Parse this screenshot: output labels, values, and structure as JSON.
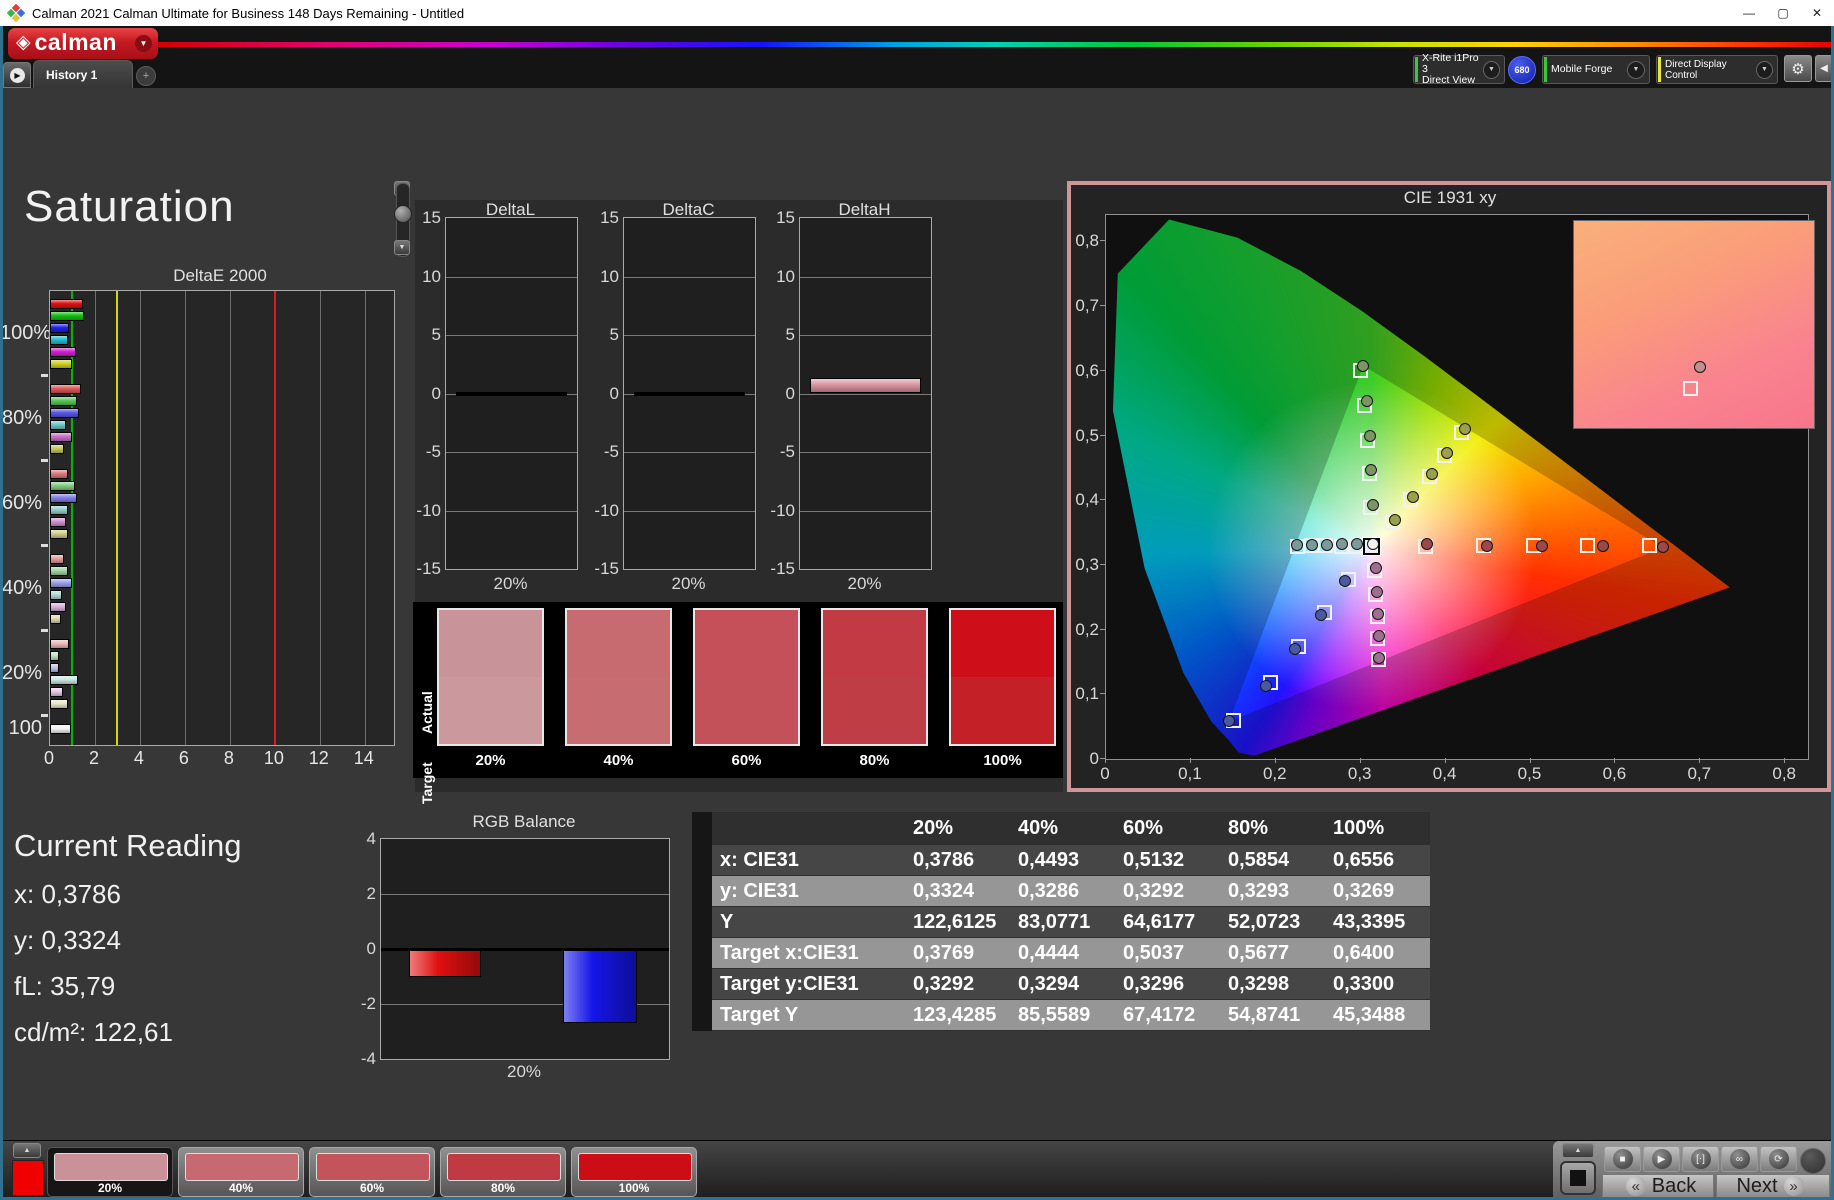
{
  "titlebar": {
    "title": "Calman 2021 Calman Ultimate for Business 148 Days Remaining  - Untitled",
    "buttons": [
      {
        "name": "minimize-button",
        "glyph": "—"
      },
      {
        "name": "maximize-button",
        "glyph": "▢"
      },
      {
        "name": "close-button",
        "glyph": "✕"
      }
    ]
  },
  "appbar": {
    "logo_text": "calman",
    "logo_diamond_glyph": "◈",
    "logo_arrow_glyph": "▼"
  },
  "tabs": {
    "play_glyph": "▶",
    "history_label": "History 1",
    "add_label": "+"
  },
  "meters": {
    "meter_line1": "X-Rite i1Pro 3",
    "meter_line2": "Direct View",
    "badge": "680",
    "source_label": "Mobile Forge",
    "control_label": "Direct Display Control",
    "gear_glyph": "⚙",
    "collapse_glyph": "◀",
    "meter_accent": "#3cc83c",
    "source_accent": "#3cc83c",
    "control_accent": "#e8e83c"
  },
  "page": {
    "title": "Saturation"
  },
  "deltae": {
    "title": "DeltaE 2000",
    "type": "bar",
    "axis_max": 15.3,
    "x_ticks": [
      "0",
      "2",
      "4",
      "6",
      "8",
      "10",
      "12",
      "14"
    ],
    "x_tick_values": [
      0,
      2,
      4,
      6,
      8,
      10,
      12,
      14
    ],
    "thresholds": [
      {
        "value": 1,
        "color": "#00b400"
      },
      {
        "value": 3,
        "color": "#d8d800"
      },
      {
        "value": 10,
        "color": "#e01818"
      }
    ],
    "groups": [
      {
        "label": "100%",
        "values": [
          1.47,
          1.51,
          0.86,
          0.79,
          1.16,
          0.97
        ],
        "colors": [
          "#e01010",
          "#10c010",
          "#2020f0",
          "#20c0d0",
          "#d020d0",
          "#d0d020"
        ]
      },
      {
        "label": "80%",
        "values": [
          1.37,
          1.22,
          1.27,
          0.72,
          0.97,
          0.61
        ],
        "colors": [
          "#df5858",
          "#58c858",
          "#5858e8",
          "#70c8c8",
          "#c870c8",
          "#c8c860"
        ]
      },
      {
        "label": "60%",
        "values": [
          0.82,
          1.09,
          1.22,
          0.79,
          0.69,
          0.79
        ],
        "colors": [
          "#e07878",
          "#80d080",
          "#8080e8",
          "#90d0cc",
          "#d090d0",
          "#d0d088"
        ]
      },
      {
        "label": "40%",
        "values": [
          0.61,
          0.79,
          0.99,
          0.52,
          0.72,
          0.48
        ],
        "colors": [
          "#e49c9c",
          "#a0d8a0",
          "#a0a0ec",
          "#b0dcd8",
          "#dcb0dc",
          "#dcdca8"
        ]
      },
      {
        "label": "20%",
        "values": [
          0.83,
          0.42,
          0.38,
          1.24,
          0.56,
          0.79
        ],
        "colors": [
          "#ecb8b8",
          "#c0e4c0",
          "#c0c0f0",
          "#cce8e4",
          "#e8c8e8",
          "#e8e8c8"
        ]
      },
      {
        "label": "100",
        "values": [
          0.93
        ],
        "colors": [
          "#f5f5f5"
        ]
      }
    ]
  },
  "delta_charts": {
    "x_label": "20%",
    "y_ticks": [
      "15",
      "10",
      "5",
      "0",
      "-5",
      "-10",
      "-15"
    ],
    "y_tick_values": [
      15,
      10,
      5,
      0,
      -5,
      -10,
      -15
    ],
    "charts": [
      {
        "title": "DeltaL",
        "value": 0.0,
        "color": "#111111"
      },
      {
        "title": "DeltaC",
        "value": 0.0,
        "color": "#111111"
      },
      {
        "title": "DeltaH",
        "value": 1.3,
        "color": "#d893a0"
      }
    ]
  },
  "swatch_strip": {
    "row_labels": [
      "Actual",
      "Target"
    ],
    "columns": [
      {
        "label": "20%",
        "actual": "#c9939a",
        "target": "#cb989e"
      },
      {
        "label": "40%",
        "actual": "#c76b70",
        "target": "#c76d72"
      },
      {
        "label": "60%",
        "actual": "#c65059",
        "target": "#c35159"
      },
      {
        "label": "80%",
        "actual": "#c23b44",
        "target": "#bf3e46"
      },
      {
        "label": "100%",
        "actual": "#ce0e18",
        "target": "#c32028"
      }
    ]
  },
  "cie": {
    "title": "CIE 1931 xy",
    "x_ticks": [
      "0",
      "0,1",
      "0,2",
      "0,3",
      "0,4",
      "0,5",
      "0,6",
      "0,7",
      "0,8"
    ],
    "y_ticks": [
      "0",
      "0,1",
      "0,2",
      "0,3",
      "0,4",
      "0,5",
      "0,6",
      "0,7",
      "0,8"
    ],
    "tick_values": [
      0,
      0.1,
      0.2,
      0.3,
      0.4,
      0.5,
      0.6,
      0.7,
      0.8
    ],
    "white_point": {
      "target": [
        0.3127,
        0.329
      ],
      "measured": [
        0.315,
        0.332
      ],
      "circle_color": "#f2f2f2"
    },
    "gamut_triangle": [
      [
        0.6556,
        0.3269
      ],
      [
        0.303,
        0.608
      ],
      [
        0.145,
        0.058
      ]
    ],
    "locus": [
      [
        0.1741,
        0.005
      ],
      [
        0.156,
        0.01
      ],
      [
        0.144,
        0.0297
      ],
      [
        0.1241,
        0.0578
      ],
      [
        0.0913,
        0.1327
      ],
      [
        0.0454,
        0.295
      ],
      [
        0.0082,
        0.5384
      ],
      [
        0.0139,
        0.7502
      ],
      [
        0.0743,
        0.8338
      ],
      [
        0.1547,
        0.8059
      ],
      [
        0.2296,
        0.7543
      ],
      [
        0.3016,
        0.6923
      ],
      [
        0.3731,
        0.6245
      ],
      [
        0.4441,
        0.5547
      ],
      [
        0.5125,
        0.4866
      ],
      [
        0.5752,
        0.4242
      ],
      [
        0.627,
        0.3725
      ],
      [
        0.6658,
        0.334
      ],
      [
        0.6915,
        0.3083
      ],
      [
        0.7347,
        0.2653
      ]
    ],
    "sweeps": [
      {
        "name": "red",
        "circle_color": "#9a4848",
        "targets": [
          [
            0.3769,
            0.3292
          ],
          [
            0.4444,
            0.3294
          ],
          [
            0.5037,
            0.3296
          ],
          [
            0.5677,
            0.3298
          ],
          [
            0.64,
            0.33
          ]
        ],
        "measured": [
          [
            0.3786,
            0.3324
          ],
          [
            0.4493,
            0.3286
          ],
          [
            0.5132,
            0.3292
          ],
          [
            0.5854,
            0.3293
          ],
          [
            0.6556,
            0.3269
          ]
        ]
      },
      {
        "name": "green",
        "circle_color": "#7d9464",
        "targets": [
          [
            0.3118,
            0.3888
          ],
          [
            0.3102,
            0.4408
          ],
          [
            0.308,
            0.493
          ],
          [
            0.3047,
            0.546
          ],
          [
            0.3,
            0.6
          ]
        ],
        "measured": [
          [
            0.314,
            0.393
          ],
          [
            0.3125,
            0.446
          ],
          [
            0.3105,
            0.499
          ],
          [
            0.3075,
            0.553
          ],
          [
            0.303,
            0.608
          ]
        ]
      },
      {
        "name": "blue",
        "circle_color": "#4a5a9e",
        "targets": [
          [
            0.286,
            0.278
          ],
          [
            0.257,
            0.226
          ],
          [
            0.227,
            0.174
          ],
          [
            0.194,
            0.119
          ],
          [
            0.15,
            0.06
          ]
        ],
        "measured": [
          [
            0.282,
            0.275
          ],
          [
            0.253,
            0.223
          ],
          [
            0.223,
            0.17
          ],
          [
            0.189,
            0.113
          ],
          [
            0.145,
            0.058
          ]
        ]
      },
      {
        "name": "cyan",
        "circle_color": "#7d9a9a",
        "targets": [
          [
            0.295,
            0.3291
          ],
          [
            0.277,
            0.3292
          ],
          [
            0.259,
            0.3294
          ],
          [
            0.242,
            0.3296
          ],
          [
            0.225,
            0.329
          ]
        ],
        "measured": [
          [
            0.296,
            0.332
          ],
          [
            0.278,
            0.3318
          ],
          [
            0.26,
            0.3315
          ],
          [
            0.243,
            0.3312
          ],
          [
            0.2255,
            0.3305
          ]
        ]
      },
      {
        "name": "magenta",
        "circle_color": "#9e7090",
        "targets": [
          [
            0.316,
            0.291
          ],
          [
            0.318,
            0.255
          ],
          [
            0.3193,
            0.221
          ],
          [
            0.3203,
            0.187
          ],
          [
            0.3209,
            0.1542
          ]
        ],
        "measured": [
          [
            0.318,
            0.295
          ],
          [
            0.3195,
            0.258
          ],
          [
            0.3205,
            0.224
          ],
          [
            0.321,
            0.19
          ],
          [
            0.3215,
            0.156
          ]
        ]
      },
      {
        "name": "yellow",
        "circle_color": "#9aa04e",
        "targets": [
          [
            0.337,
            0.365
          ],
          [
            0.359,
            0.401
          ],
          [
            0.381,
            0.437
          ],
          [
            0.399,
            0.469
          ],
          [
            0.419,
            0.505
          ]
        ],
        "measured": [
          [
            0.34,
            0.369
          ],
          [
            0.362,
            0.405
          ],
          [
            0.384,
            0.441
          ],
          [
            0.402,
            0.473
          ],
          [
            0.423,
            0.51
          ]
        ]
      }
    ],
    "inset": {
      "circle": [
        0.527,
        0.705
      ],
      "square": [
        0.487,
        0.81
      ],
      "circle_color": "#c09090"
    }
  },
  "current_reading": {
    "title": "Current Reading",
    "lines": [
      "x: 0,3786",
      "y: 0,3324",
      "fL: 35,79",
      "cd/m²: 122,61"
    ]
  },
  "rgb_balance": {
    "title": "RGB Balance",
    "x_label": "20%",
    "y_ticks": [
      "4",
      "2",
      "0",
      "-2",
      "-4"
    ],
    "y_tick_values": [
      4,
      2,
      0,
      -2,
      -4
    ],
    "bars": [
      {
        "name": "red",
        "value": -1.0,
        "color": "#e01010",
        "x": 28,
        "w": 72
      },
      {
        "name": "blue",
        "value": -2.7,
        "color": "#1515e8",
        "x": 182,
        "w": 74
      }
    ]
  },
  "table": {
    "headers": [
      "",
      "20%",
      "40%",
      "60%",
      "80%",
      "100%"
    ],
    "rows": [
      {
        "label": "x: CIE31",
        "values": [
          "0,3786",
          "0,4493",
          "0,5132",
          "0,5854",
          "0,6556"
        ]
      },
      {
        "label": "y: CIE31",
        "values": [
          "0,3324",
          "0,3286",
          "0,3292",
          "0,3293",
          "0,3269"
        ]
      },
      {
        "label": "Y",
        "values": [
          "122,6125",
          "83,0771",
          "64,6177",
          "52,0723",
          "43,3395"
        ]
      },
      {
        "label": "Target x:CIE31",
        "values": [
          "0,3769",
          "0,4444",
          "0,5037",
          "0,5677",
          "0,6400"
        ]
      },
      {
        "label": "Target y:CIE31",
        "values": [
          "0,3292",
          "0,3294",
          "0,3296",
          "0,3298",
          "0,3300"
        ]
      },
      {
        "label": "Target Y",
        "values": [
          "123,4285",
          "85,5589",
          "67,4172",
          "54,8741",
          "45,3488"
        ]
      }
    ]
  },
  "bottombar": {
    "pattern_color": "#f00000",
    "swatches": [
      {
        "label": "20%",
        "color": "#cb9198",
        "selected": true
      },
      {
        "label": "40%",
        "color": "#c76a70",
        "selected": false
      },
      {
        "label": "60%",
        "color": "#c4545c",
        "selected": false
      },
      {
        "label": "80%",
        "color": "#c03a43",
        "selected": false
      },
      {
        "label": "100%",
        "color": "#cd0d15",
        "selected": false
      }
    ],
    "transport_icons": [
      {
        "name": "stop-icon",
        "glyph": "■"
      },
      {
        "name": "play-icon",
        "glyph": "▶"
      },
      {
        "name": "interval-icon",
        "glyph": "[⋅]"
      },
      {
        "name": "continuous-icon",
        "glyph": "∞"
      },
      {
        "name": "refresh-icon",
        "glyph": "⟳"
      }
    ],
    "back_label": "Back",
    "next_label": "Next",
    "back_chevron": "«",
    "next_chevron": "»"
  }
}
